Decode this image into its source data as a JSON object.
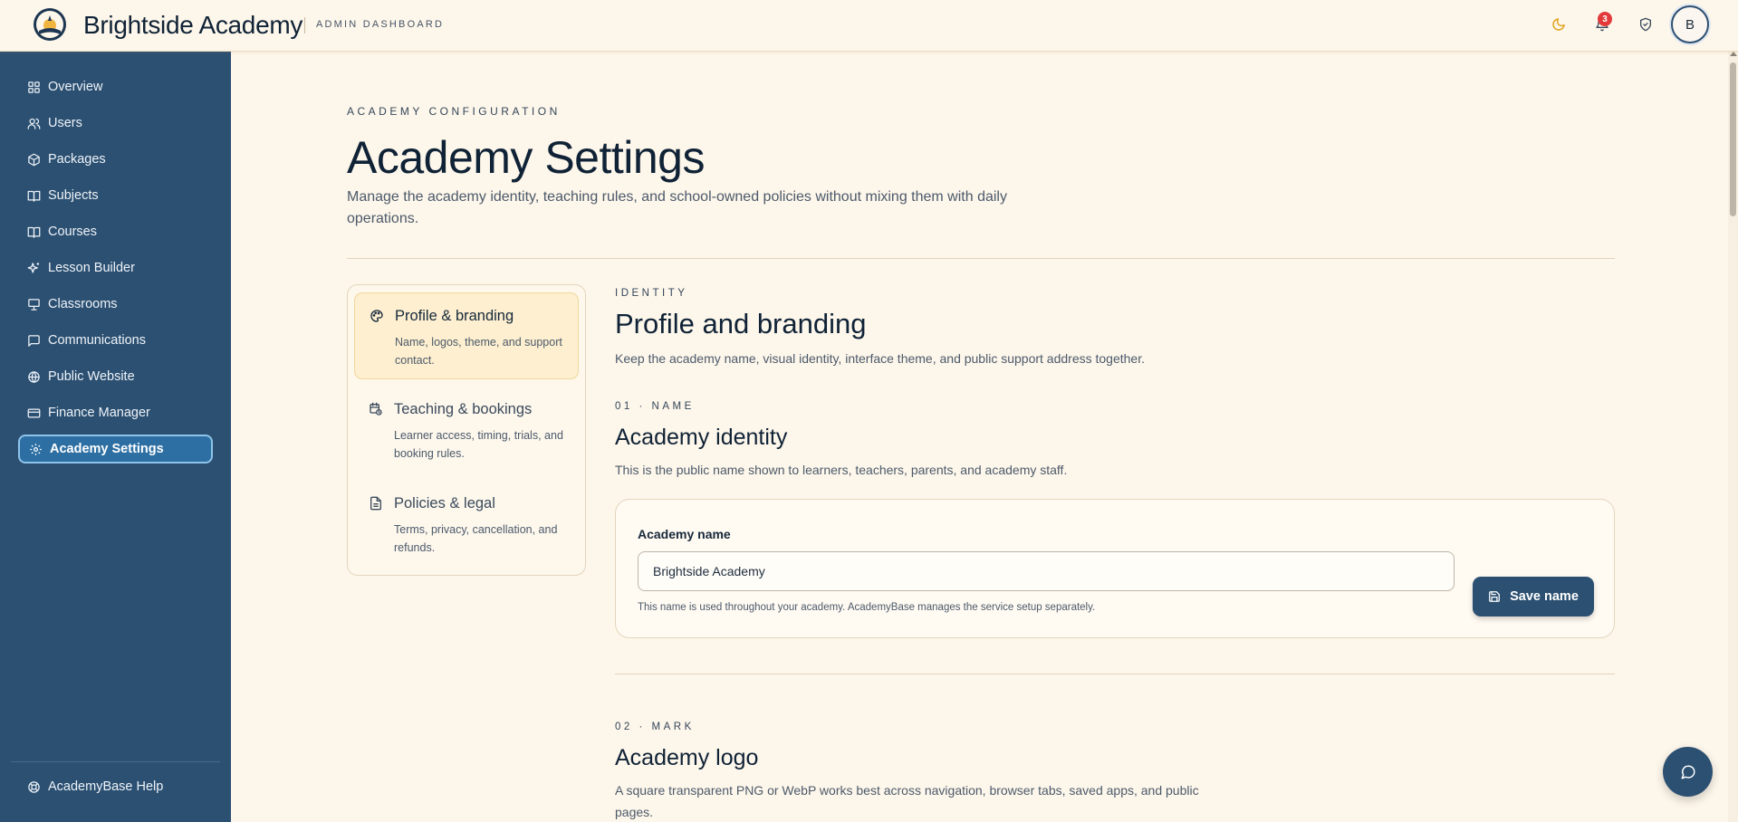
{
  "header": {
    "brand_name": "Brightside Academy",
    "brand_sub": "ADMIN DASHBOARD",
    "notification_count": "3",
    "avatar_initial": "B",
    "icons": [
      "moon-icon",
      "bell-icon",
      "shield-check-icon"
    ]
  },
  "sidebar": {
    "items": [
      {
        "label": "Overview",
        "icon": "grid-icon"
      },
      {
        "label": "Users",
        "icon": "users-icon"
      },
      {
        "label": "Packages",
        "icon": "package-icon"
      },
      {
        "label": "Subjects",
        "icon": "book-open-icon"
      },
      {
        "label": "Courses",
        "icon": "book-icon"
      },
      {
        "label": "Lesson Builder",
        "icon": "sparkles-icon"
      },
      {
        "label": "Classrooms",
        "icon": "presentation-icon"
      },
      {
        "label": "Communications",
        "icon": "message-icon"
      },
      {
        "label": "Public Website",
        "icon": "globe-icon"
      },
      {
        "label": "Finance Manager",
        "icon": "credit-card-icon"
      },
      {
        "label": "Academy Settings",
        "icon": "gear-icon",
        "active": true
      }
    ],
    "help_label": "AcademyBase Help"
  },
  "page": {
    "eyebrow": "ACADEMY CONFIGURATION",
    "title": "Academy Settings",
    "description": "Manage the academy identity, teaching rules, and school-owned policies without mixing them with daily operations."
  },
  "settings_menu": [
    {
      "title": "Profile & branding",
      "desc": "Name, logos, theme, and support contact.",
      "active": true
    },
    {
      "title": "Teaching & bookings",
      "desc": "Learner access, timing, trials, and booking rules."
    },
    {
      "title": "Policies & legal",
      "desc": "Terms, privacy, cancellation, and refunds."
    }
  ],
  "identity": {
    "eyebrow": "IDENTITY",
    "title": "Profile and branding",
    "desc": "Keep the academy name, visual identity, interface theme, and public support address together."
  },
  "name_section": {
    "eyebrow": "01 · NAME",
    "title": "Academy identity",
    "desc": "This is the public name shown to learners, teachers, parents, and academy staff.",
    "field_label": "Academy name",
    "field_value": "Brightside Academy",
    "help": "This name is used throughout your academy. AcademyBase manages the service setup separately.",
    "save_label": "Save name"
  },
  "mark_section": {
    "eyebrow": "02 · MARK",
    "title": "Academy logo",
    "desc": "A square transparent PNG or WebP works best across navigation, browser tabs, saved apps, and public pages."
  },
  "colors": {
    "sidebar": "#2c5072",
    "background": "#fdf6ea",
    "active_menu": "#fdefcf",
    "badge": "#e23a3a"
  }
}
